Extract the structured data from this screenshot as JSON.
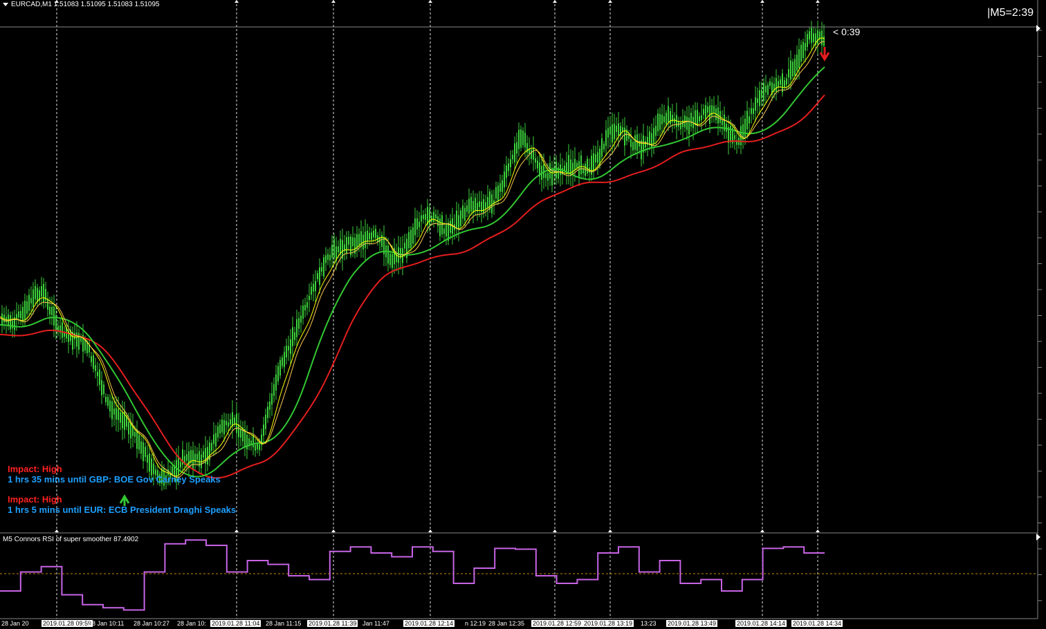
{
  "window": {
    "title": "EURCAD,M1  1.51083 1.51095 1.51083 1.51095",
    "timer": "|M5=2:39",
    "countdown": "< 0:39"
  },
  "news": [
    {
      "impact": "Impact: High",
      "text": "1 hrs 35 mins until GBP: BOE Gov Carney Speaks"
    },
    {
      "impact": "Impact: High",
      "text": "1 hrs 5 mins until EUR: ECB President Draghi Speaks"
    }
  ],
  "indicator": {
    "title": "M5 Connors RSI of super smoother 87.4902"
  },
  "time_axis": {
    "labels": [
      {
        "text": "28 Jan 20",
        "boxed": false
      },
      {
        "text": "2019.01.28 09:59",
        "boxed": true
      },
      {
        "text": "28 Jan 10:11",
        "boxed": false
      },
      {
        "text": "28 Jan 10:27",
        "boxed": false
      },
      {
        "text": "28 Jan 10:",
        "boxed": false
      },
      {
        "text": "2019.01.28 11:04",
        "boxed": true
      },
      {
        "text": "28 Jan 11:15",
        "boxed": false
      },
      {
        "text": "2019.01.28 11:39",
        "boxed": true
      },
      {
        "text": "Jan 11:47",
        "boxed": false
      },
      {
        "text": "2019.01.28 12:14",
        "boxed": true
      },
      {
        "text": "n 12:19",
        "boxed": false
      },
      {
        "text": "28 Jan 12:35",
        "boxed": false
      },
      {
        "text": "2019.01.28 12:59",
        "boxed": true
      },
      {
        "text": "2019.01.28 13:19",
        "boxed": true
      },
      {
        "text": "13:23",
        "boxed": false
      },
      {
        "text": "2019.01.28 13:49",
        "boxed": true
      },
      {
        "text": "2019.01.28 14:14",
        "boxed": true
      },
      {
        "text": "2019.01.28 14:34",
        "boxed": true
      }
    ]
  },
  "colors": {
    "background": "#000000",
    "candles": "#3cd23c",
    "ma_fast": "#ffff00",
    "ma_mid": "#32c832",
    "ma_slow": "#e61e1e",
    "rsi": "#c864e6",
    "level": "#c88c00",
    "impact": "#ff2020",
    "news_text": "#1ea0ff",
    "grid": "#ffffff"
  },
  "chart_data": {
    "type": "line",
    "symbol": "EURCAD",
    "timeframe": "M1",
    "bid_quote": [
      1.51083,
      1.51095,
      1.51083,
      1.51095
    ],
    "price_trend_shape": [
      0.4,
      0.45,
      0.3,
      0.12,
      0.06,
      0.14,
      0.12,
      0.45,
      0.58,
      0.52,
      0.62,
      0.63,
      0.75,
      0.7,
      0.8,
      0.78,
      0.84,
      0.82,
      0.92,
      1.0
    ],
    "rsi_value": 87.4902,
    "rsi_levels": [
      50
    ]
  }
}
